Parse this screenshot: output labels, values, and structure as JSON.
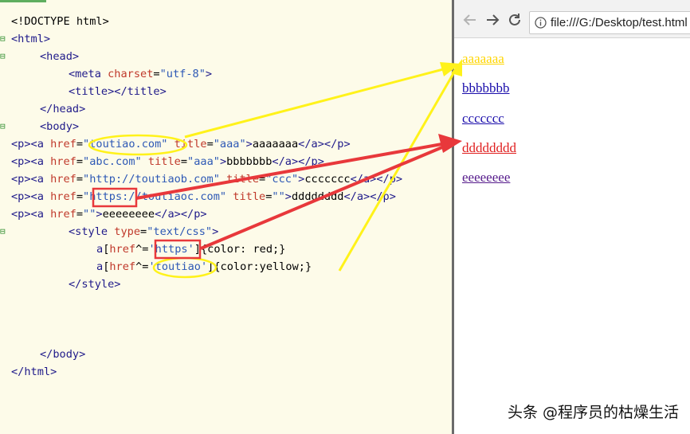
{
  "editor": {
    "lines": [
      [
        {
          "c": "punc",
          "t": "<!DOCTYPE html>"
        }
      ],
      [
        {
          "c": "tag",
          "t": "<html>"
        }
      ],
      [
        {
          "c": "tag",
          "t": "<head>"
        }
      ],
      [
        {
          "c": "tag",
          "t": "<meta "
        },
        {
          "c": "attr",
          "t": "charset"
        },
        {
          "c": "punc",
          "t": "="
        },
        {
          "c": "str",
          "t": "\"utf-8\""
        },
        {
          "c": "tag",
          "t": ">"
        }
      ],
      [
        {
          "c": "tag",
          "t": "<title></title>"
        }
      ],
      [
        {
          "c": "tag",
          "t": "</head>"
        }
      ],
      [
        {
          "c": "tag",
          "t": "<body>"
        }
      ],
      [
        {
          "c": "tag",
          "t": "<p><a "
        },
        {
          "c": "attr",
          "t": "href"
        },
        {
          "c": "punc",
          "t": "="
        },
        {
          "c": "str",
          "t": "\"toutiao.com\""
        },
        {
          "c": "punc",
          "t": " "
        },
        {
          "c": "attr",
          "t": "title"
        },
        {
          "c": "punc",
          "t": "="
        },
        {
          "c": "str",
          "t": "\"aaa\""
        },
        {
          "c": "tag",
          "t": ">"
        },
        {
          "c": "punc",
          "t": "aaaaaaa"
        },
        {
          "c": "tag",
          "t": "</a></p>"
        }
      ],
      [
        {
          "c": "tag",
          "t": "<p><a "
        },
        {
          "c": "attr",
          "t": "href"
        },
        {
          "c": "punc",
          "t": "="
        },
        {
          "c": "str",
          "t": "\"abc.com\""
        },
        {
          "c": "punc",
          "t": " "
        },
        {
          "c": "attr",
          "t": "title"
        },
        {
          "c": "punc",
          "t": "="
        },
        {
          "c": "str",
          "t": "\"aaa\""
        },
        {
          "c": "tag",
          "t": ">"
        },
        {
          "c": "punc",
          "t": "bbbbbbb"
        },
        {
          "c": "tag",
          "t": "</a></p>"
        }
      ],
      [
        {
          "c": "tag",
          "t": "<p><a "
        },
        {
          "c": "attr",
          "t": "href"
        },
        {
          "c": "punc",
          "t": "="
        },
        {
          "c": "str",
          "t": "\"http://toutiaob.com\""
        },
        {
          "c": "punc",
          "t": " "
        },
        {
          "c": "attr",
          "t": "title"
        },
        {
          "c": "punc",
          "t": "="
        },
        {
          "c": "str",
          "t": "\"ccc\""
        },
        {
          "c": "tag",
          "t": ">"
        },
        {
          "c": "punc",
          "t": "ccccccc"
        },
        {
          "c": "tag",
          "t": "</a></p>"
        }
      ],
      [
        {
          "c": "tag",
          "t": "<p><a "
        },
        {
          "c": "attr",
          "t": "href"
        },
        {
          "c": "punc",
          "t": "="
        },
        {
          "c": "str",
          "t": "\"https://toutiaoc.com\""
        },
        {
          "c": "punc",
          "t": " "
        },
        {
          "c": "attr",
          "t": "title"
        },
        {
          "c": "punc",
          "t": "="
        },
        {
          "c": "str",
          "t": "\"\""
        },
        {
          "c": "tag",
          "t": ">"
        },
        {
          "c": "punc",
          "t": "dddddddd"
        },
        {
          "c": "tag",
          "t": "</a></p>"
        }
      ],
      [
        {
          "c": "tag",
          "t": "<p><a "
        },
        {
          "c": "attr",
          "t": "href"
        },
        {
          "c": "punc",
          "t": "="
        },
        {
          "c": "str",
          "t": "\"\""
        },
        {
          "c": "tag",
          "t": ">"
        },
        {
          "c": "punc",
          "t": "eeeeeeee"
        },
        {
          "c": "tag",
          "t": "</a></p>"
        }
      ],
      [
        {
          "c": "tag",
          "t": "<style "
        },
        {
          "c": "attr",
          "t": "type"
        },
        {
          "c": "punc",
          "t": "="
        },
        {
          "c": "str",
          "t": "\"text/css\""
        },
        {
          "c": "tag",
          "t": ">"
        }
      ],
      [
        {
          "c": "tag",
          "t": "a"
        },
        {
          "c": "punc",
          "t": "["
        },
        {
          "c": "attr",
          "t": "href"
        },
        {
          "c": "punc",
          "t": "^="
        },
        {
          "c": "str",
          "t": "'https'"
        },
        {
          "c": "punc",
          "t": "]{"
        },
        {
          "c": "css-prop",
          "t": "color: red;"
        },
        {
          "c": "punc",
          "t": "}"
        }
      ],
      [
        {
          "c": "tag",
          "t": "a"
        },
        {
          "c": "punc",
          "t": "["
        },
        {
          "c": "attr",
          "t": "href"
        },
        {
          "c": "punc",
          "t": "^="
        },
        {
          "c": "str",
          "t": "'toutiao'"
        },
        {
          "c": "punc",
          "t": "]{"
        },
        {
          "c": "css-prop",
          "t": "color:yellow;"
        },
        {
          "c": "punc",
          "t": "}"
        }
      ],
      [
        {
          "c": "tag",
          "t": "</style>"
        }
      ],
      [],
      [],
      [],
      [
        {
          "c": "tag",
          "t": "</body>"
        }
      ],
      [
        {
          "c": "tag",
          "t": "</html>"
        }
      ]
    ]
  },
  "browser": {
    "url": "file:///G:/Desktop/test.html",
    "links": [
      {
        "text": "aaaaaaa",
        "color": "#ffd600"
      },
      {
        "text": "bbbbbbb",
        "color": "#1a0dab"
      },
      {
        "text": "ccccccc",
        "color": "#1a0dab"
      },
      {
        "text": "dddddddd",
        "color": "#e02020"
      },
      {
        "text": "eeeeeeee",
        "color": "#551a8b"
      }
    ]
  },
  "watermark": "头条 @程序员的枯燥生活",
  "colors": {
    "annotation_yellow": "#fff21a",
    "annotation_red": "#e8383b"
  }
}
